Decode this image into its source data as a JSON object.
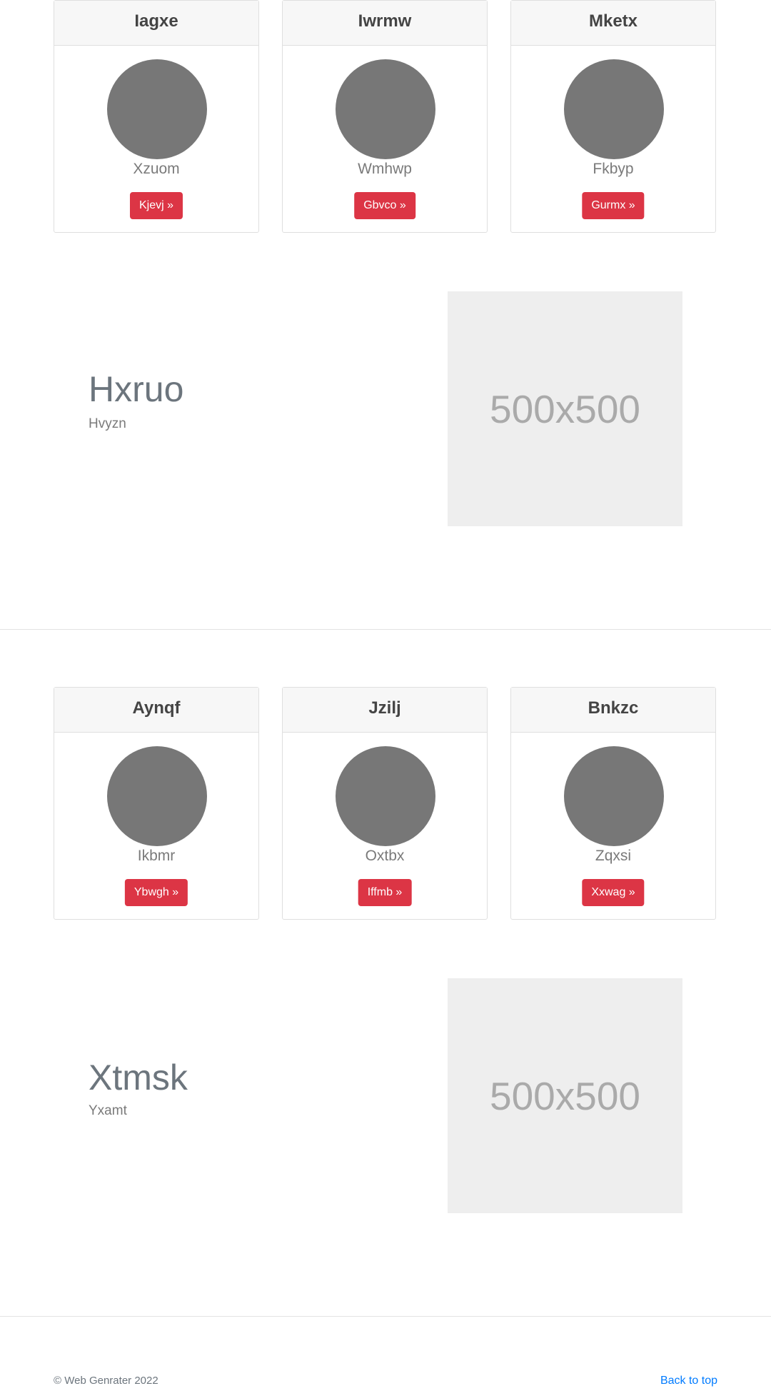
{
  "sections": [
    {
      "cards": [
        {
          "title": "Iagxe",
          "subtitle": "Xzuom",
          "button": "Kjevj »"
        },
        {
          "title": "Iwrmw",
          "subtitle": "Wmhwp",
          "button": "Gbvco »"
        },
        {
          "title": "Mketx",
          "subtitle": "Fkbyp",
          "button": "Gurmx »"
        }
      ],
      "feature": {
        "heading": "Hxruo",
        "subheading": "Hvyzn",
        "image_label": "500x500"
      }
    },
    {
      "cards": [
        {
          "title": "Aynqf",
          "subtitle": "Ikbmr",
          "button": "Ybwgh »"
        },
        {
          "title": "Jzilj",
          "subtitle": "Oxtbx",
          "button": "Iffmb »"
        },
        {
          "title": "Bnkzc",
          "subtitle": "Zqxsi",
          "button": "Xxwag »"
        }
      ],
      "feature": {
        "heading": "Xtmsk",
        "subheading": "Yxamt",
        "image_label": "500x500"
      }
    }
  ],
  "footer": {
    "copyright": "© Web Genrater 2022",
    "back_to_top": "Back to top"
  },
  "colors": {
    "button": "#dc3545",
    "avatar": "#777777",
    "link": "#007bff",
    "placeholder_bg": "#eeeeee"
  }
}
